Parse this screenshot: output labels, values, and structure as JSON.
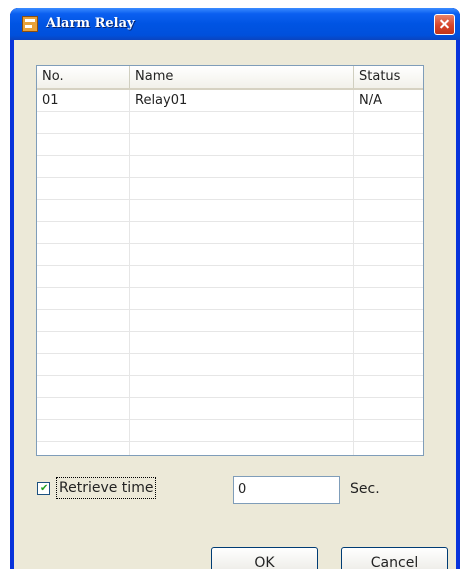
{
  "window": {
    "title": "Alarm Relay"
  },
  "table": {
    "columns": [
      "No.",
      "Name",
      "Status"
    ],
    "rows": [
      {
        "no": "01",
        "name": "Relay01",
        "status": "N/A"
      }
    ]
  },
  "retrieve": {
    "label": "Retrieve time",
    "checked": true,
    "value": "0",
    "unit": "Sec."
  },
  "buttons": {
    "ok": "OK",
    "cancel": "Cancel"
  },
  "colors": {
    "titlebar": "#0054e3",
    "dialog_bg": "#ece9d8",
    "close_button": "#d7452a"
  }
}
